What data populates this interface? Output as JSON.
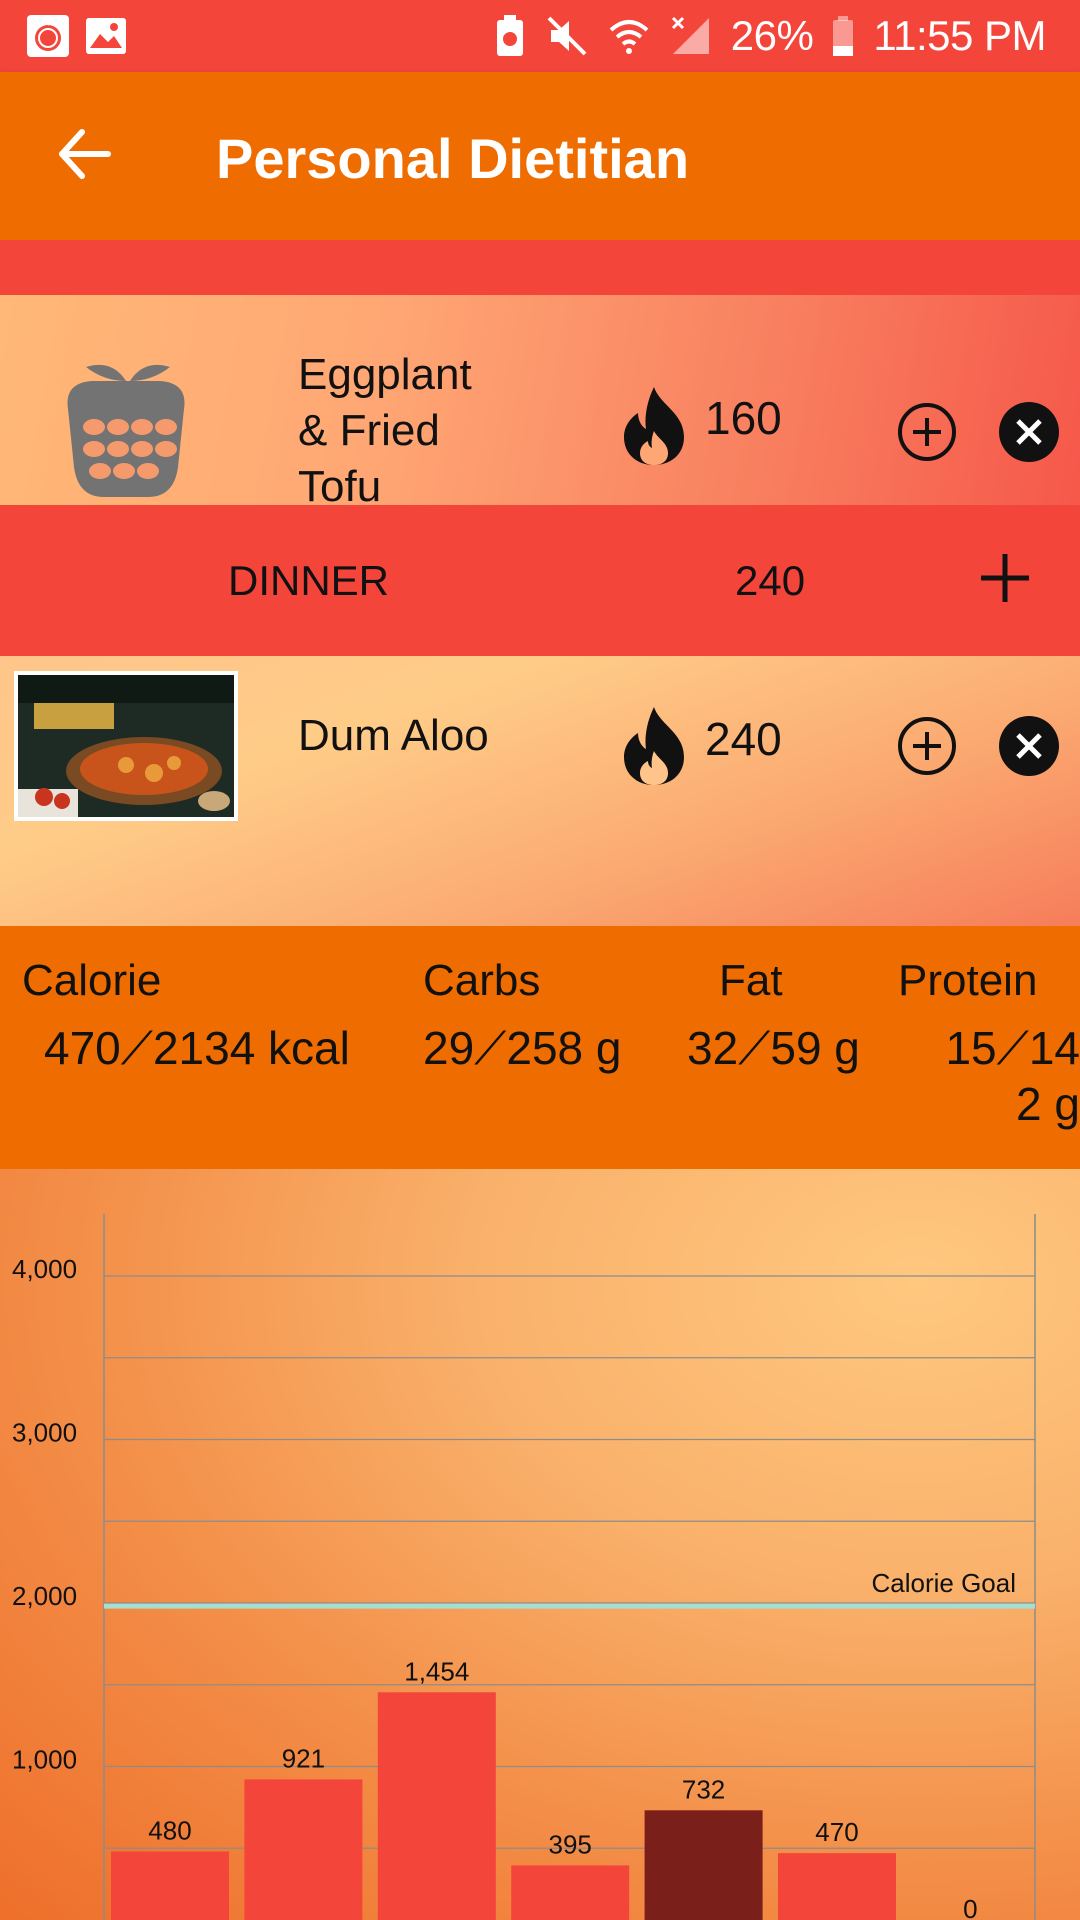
{
  "status_bar": {
    "battery": "26%",
    "time": "11:55 PM"
  },
  "app_bar": {
    "title": "Personal Dietitian"
  },
  "meals": [
    {
      "name": "Eggplant\n& Fried\nTofu",
      "calories": "160"
    }
  ],
  "dinner": {
    "label": "DINNER",
    "calories": "240",
    "items": [
      {
        "name": "Dum Aloo",
        "calories": "240"
      }
    ]
  },
  "summary": {
    "calorie_label": "Calorie",
    "calorie_value": "470⟋2134 kcal",
    "carbs_label": "Carbs",
    "carbs_value": "29⟋258 g",
    "fat_label": "Fat",
    "fat_value": "32⟋59 g",
    "protein_label": "Protein",
    "protein_value": "15⟋142 g"
  },
  "chart_data": {
    "type": "bar",
    "categories": [
      "",
      "",
      "",
      "",
      "",
      "",
      ""
    ],
    "values": [
      480,
      921,
      1454,
      395,
      732,
      470,
      0
    ],
    "value_labels": [
      "480",
      "921",
      "1,454",
      "395",
      "732",
      "470",
      "0"
    ],
    "highlight_index": 4,
    "y_ticks": [
      "1,000",
      "2,000",
      "3,000",
      "4,000"
    ],
    "goal_value": 2134,
    "goal_label": "Calorie Goal",
    "colors": {
      "bar": "#f4453a",
      "bar_highlight": "#7b1f1a",
      "goal_line": "#a6dfd2",
      "grid": "#8c8c8c"
    }
  }
}
